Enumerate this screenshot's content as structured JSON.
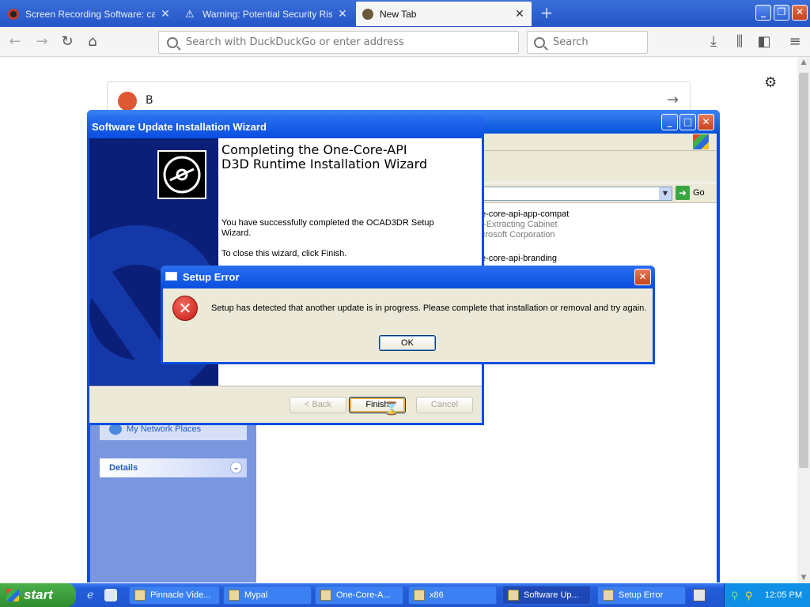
{
  "browser": {
    "tabs": [
      {
        "title": "Screen Recording Software: captu",
        "icon": "record-icon",
        "color": "#c0392b"
      },
      {
        "title": "Warning: Potential Security Risk A",
        "icon": "warning-icon",
        "color": "#ffffff"
      },
      {
        "title": "New Tab",
        "icon": "firefox-icon",
        "color": "#5a6a7a"
      }
    ],
    "new_tab_symbol": "+",
    "url_placeholder": "Search with DuckDuckGo or enter address",
    "search_placeholder": "Search"
  },
  "newtab": {
    "search_text": "B"
  },
  "explorer": {
    "address_go": "Go",
    "files": [
      {
        "name": "e-core-api-app-compat",
        "type": "f-Extracting Cabinet",
        "company": "crosoft Corporation"
      },
      {
        "name": "e-core-api-branding"
      }
    ],
    "network_places": "My Network Places",
    "details_label": "Details"
  },
  "wizard": {
    "title": "Software Update Installation Wizard",
    "heading_line1": "Completing the One-Core-API",
    "heading_line2": "D3D Runtime Installation Wizard",
    "p1": "You have successfully completed the OCAD3DR Setup Wizard.",
    "p2": "To close this wizard, click Finish.",
    "back": "< Back",
    "finish": "Finish",
    "cancel": "Cancel"
  },
  "error": {
    "title": "Setup Error",
    "message": "Setup has detected that another update is in progress.  Please complete that installation or removal and try again.",
    "ok": "OK"
  },
  "taskbar": {
    "start": "start",
    "tasks": [
      {
        "label": "Pinnacle Vide..."
      },
      {
        "label": "Mypal"
      },
      {
        "label": "One-Core-A..."
      },
      {
        "label": "x86"
      },
      {
        "label": "Software Up..."
      },
      {
        "label": "Setup Error"
      }
    ],
    "clock": "12:05 PM"
  }
}
